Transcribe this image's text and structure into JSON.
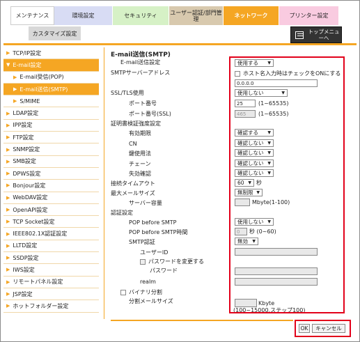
{
  "tabs": {
    "maintenance": "メンテナンス",
    "environment": "環境設定",
    "security": "セキュリティ",
    "user_auth": "ユーザー認証/部門管理",
    "network": "ネットワーク",
    "printer": "プリンター設定"
  },
  "subtab": "カスタマイズ設定",
  "top_menu": "トップメニューへ",
  "sidebar": [
    {
      "label": "TCP/IP設定",
      "state": "normal"
    },
    {
      "label": "E-mail設定",
      "state": "active"
    },
    {
      "label": "E-mail受信(POP)",
      "state": "sub"
    },
    {
      "label": "E-mail送信(SMTP)",
      "state": "subsel"
    },
    {
      "label": "S/MIME",
      "state": "sub"
    },
    {
      "label": "LDAP設定",
      "state": "normal"
    },
    {
      "label": "IPP設定",
      "state": "normal"
    },
    {
      "label": "FTP設定",
      "state": "normal"
    },
    {
      "label": "SNMP設定",
      "state": "normal"
    },
    {
      "label": "SMB設定",
      "state": "normal"
    },
    {
      "label": "DPWS設定",
      "state": "normal"
    },
    {
      "label": "Bonjour設定",
      "state": "normal"
    },
    {
      "label": "WebDAV設定",
      "state": "normal"
    },
    {
      "label": "OpenAPI設定",
      "state": "normal"
    },
    {
      "label": "TCP Socket設定",
      "state": "normal"
    },
    {
      "label": "IEEE802.1X認証設定",
      "state": "normal"
    },
    {
      "label": "LLTD設定",
      "state": "normal"
    },
    {
      "label": "SSDP設定",
      "state": "normal"
    },
    {
      "label": "IWS設定",
      "state": "normal"
    },
    {
      "label": "リモートパネル設定",
      "state": "normal"
    },
    {
      "label": "JSP設定",
      "state": "normal"
    },
    {
      "label": "ホットフォルダー設定",
      "state": "normal"
    }
  ],
  "content": {
    "title": "E-mail送信(SMTP)",
    "email_send_label": "E-mail送信設定",
    "email_send_value": "使用する",
    "smtp_address_label": "SMTPサーバーアドレス",
    "hostname_check_label": "ホスト名入力時はチェックをONにする",
    "smtp_address_value": "0.0.0.0",
    "ssl_label": "SSL/TLS使用",
    "ssl_value": "使用しない",
    "port_label": "ポート番号",
    "port_value": "25",
    "port_range": "(1~65535)",
    "port_ssl_label": "ポート番号(SSL)",
    "port_ssl_value": "465",
    "port_ssl_range": "(1~65535)",
    "cert_label": "証明書検証強度設定",
    "validity_label": "有効期限",
    "validity_value": "確認する",
    "cn_label": "CN",
    "cn_value": "確認しない",
    "key_usage_label": "鍵使用法",
    "key_usage_value": "確認しない",
    "chain_label": "チェーン",
    "chain_value": "確認しない",
    "revocation_label": "失効確認",
    "revocation_value": "確認しない",
    "timeout_label": "接続タイムアウト",
    "timeout_value": "60",
    "timeout_unit": "秒",
    "max_mail_label": "最大メールサイズ",
    "max_mail_value": "無制限",
    "server_cap_label": "サーバー容量",
    "server_cap_unit": "Mbyte(1-100)",
    "auth_label": "認証設定",
    "pop_before_label": "POP before SMTP",
    "pop_before_value": "使用しない",
    "pop_time_label": "POP before SMTP時間",
    "pop_time_value": "0",
    "pop_time_unit": "秒 (0~60)",
    "smtp_auth_label": "SMTP認証",
    "smtp_auth_value": "無効",
    "user_id_label": "ユーザーID",
    "change_pw_label": "パスワードを変更する",
    "password_label": "パスワード",
    "realm_label": "realm",
    "binary_split_label": "バイナリ分割",
    "split_size_label": "分割メールサイズ",
    "split_size_unit": "Kbyte",
    "split_size_range": "(100~15000,ステップ100)"
  },
  "buttons": {
    "ok": "OK",
    "cancel": "キャンセル"
  }
}
